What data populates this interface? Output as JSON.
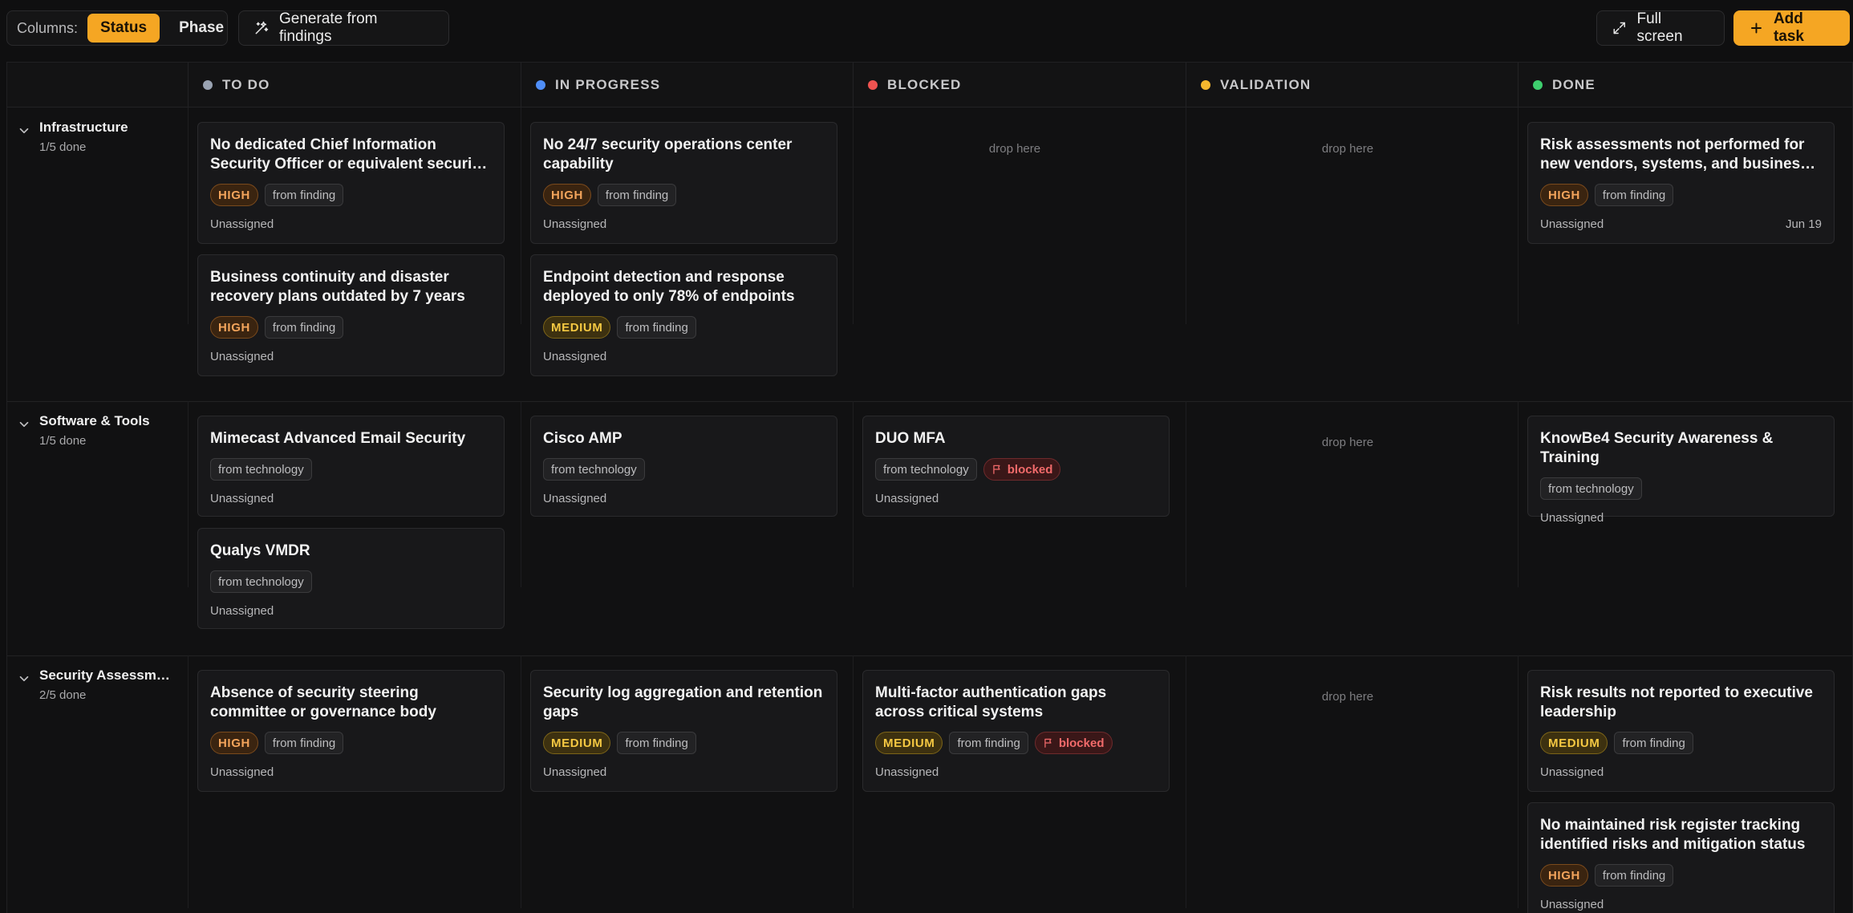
{
  "toolbar": {
    "columns_label": "Columns:",
    "group_options": [
      "Status",
      "Phase"
    ],
    "generate_label": "Generate from findings",
    "fullscreen_label": "Full screen",
    "add_task_label": "Add task"
  },
  "columns": [
    {
      "label": "TO DO",
      "color": "#9aa3b2"
    },
    {
      "label": "IN PROGRESS",
      "color": "#4f8ef7"
    },
    {
      "label": "BLOCKED",
      "color": "#ef5350"
    },
    {
      "label": "VALIDATION",
      "color": "#f5b82e"
    },
    {
      "label": "DONE",
      "color": "#3ecf6e"
    }
  ],
  "drop_text": "drop here",
  "lanes": [
    {
      "name": "Infrastructure",
      "progress": "1/5 done",
      "cards": [
        {
          "col": 0,
          "title": "No dedicated Chief Information Security Officer or equivalent security leader",
          "priority": "HIGH",
          "source": "from finding",
          "assignee": "Unassigned"
        },
        {
          "col": 0,
          "title": "Business continuity and disaster recovery plans outdated by 7 years",
          "priority": "HIGH",
          "source": "from finding",
          "assignee": "Unassigned"
        },
        {
          "col": 1,
          "title": "No 24/7 security operations center capability",
          "priority": "HIGH",
          "source": "from finding",
          "assignee": "Unassigned"
        },
        {
          "col": 1,
          "title": "Endpoint detection and response deployed to only 78% of endpoints",
          "priority": "MEDIUM",
          "source": "from finding",
          "assignee": "Unassigned"
        },
        {
          "col": 4,
          "title": "Risk assessments not performed for new vendors, systems, and business changes",
          "priority": "HIGH",
          "source": "from finding",
          "assignee": "Unassigned",
          "date": "Jun 19"
        }
      ]
    },
    {
      "name": "Software & Tools",
      "progress": "1/5 done",
      "cards": [
        {
          "col": 0,
          "title": "Mimecast Advanced Email Security",
          "source": "from technology",
          "assignee": "Unassigned"
        },
        {
          "col": 0,
          "title": "Qualys VMDR",
          "source": "from technology",
          "assignee": "Unassigned"
        },
        {
          "col": 1,
          "title": "Cisco AMP",
          "source": "from technology",
          "assignee": "Unassigned"
        },
        {
          "col": 2,
          "title": "DUO MFA",
          "source": "from technology",
          "flag": "blocked",
          "assignee": "Unassigned"
        },
        {
          "col": 4,
          "title": "KnowBe4 Security Awareness & Training",
          "source": "from technology",
          "assignee": "Unassigned"
        }
      ]
    },
    {
      "name": "Security Assessment",
      "progress": "2/5 done",
      "cards": [
        {
          "col": 0,
          "title": "Absence of security steering committee or governance body",
          "priority": "HIGH",
          "source": "from finding",
          "assignee": "Unassigned"
        },
        {
          "col": 1,
          "title": "Security log aggregation and retention gaps",
          "priority": "MEDIUM",
          "source": "from finding",
          "assignee": "Unassigned"
        },
        {
          "col": 2,
          "title": "Multi-factor authentication gaps across critical systems",
          "priority": "MEDIUM",
          "source": "from finding",
          "flag": "blocked",
          "assignee": "Unassigned"
        },
        {
          "col": 4,
          "title": "Risk results not reported to executive leadership",
          "priority": "MEDIUM",
          "source": "from finding",
          "assignee": "Unassigned"
        },
        {
          "col": 4,
          "title": "No maintained risk register tracking identified risks and mitigation status",
          "priority": "HIGH",
          "source": "from finding",
          "assignee": "Unassigned"
        }
      ]
    }
  ]
}
